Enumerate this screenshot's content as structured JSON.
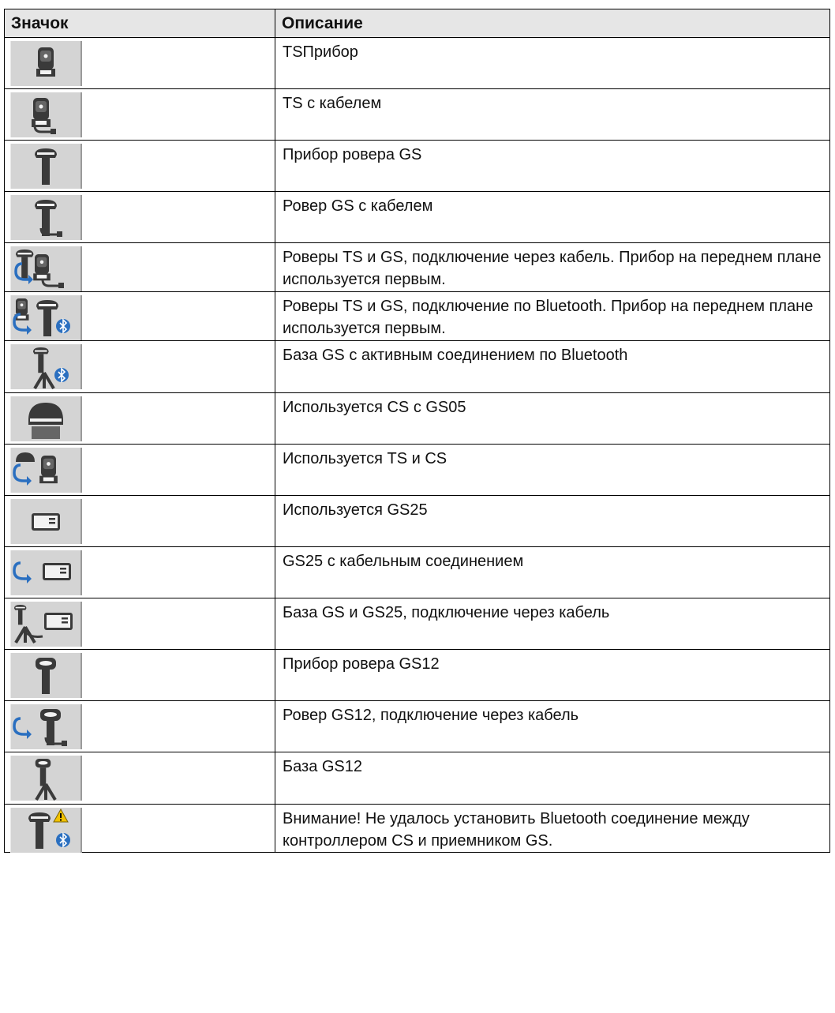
{
  "headers": {
    "icon": "Значок",
    "description": "Описание"
  },
  "rows": [
    {
      "icon": "ts-instrument-icon",
      "description": "TSПрибор"
    },
    {
      "icon": "ts-cable-icon",
      "description": "TS с кабелем"
    },
    {
      "icon": "gs-rover-icon",
      "description": "Прибор ровера GS"
    },
    {
      "icon": "gs-rover-cable-icon",
      "description": "Ровер GS с кабелем"
    },
    {
      "icon": "ts-gs-cable-icon",
      "description": "Роверы TS и GS, подключение через кабель. Прибор на переднем плане используется первым."
    },
    {
      "icon": "ts-gs-bluetooth-icon",
      "description": "Роверы TS и GS, подключение по Bluetooth. Прибор на переднем плане используется первым."
    },
    {
      "icon": "gs-base-bluetooth-icon",
      "description": "База GS с активным соединением по Bluetooth"
    },
    {
      "icon": "cs-gs05-icon",
      "description": "Используется CS с GS05"
    },
    {
      "icon": "ts-cs-icon",
      "description": "Используется TS и CS"
    },
    {
      "icon": "gs25-icon",
      "description": "Используется GS25"
    },
    {
      "icon": "gs25-cable-icon",
      "description": "GS25 с кабельным соединением"
    },
    {
      "icon": "gs-base-gs25-cable-icon",
      "description": "База GS и GS25, подключение через кабель"
    },
    {
      "icon": "gs12-rover-icon",
      "description": "Прибор ровера GS12"
    },
    {
      "icon": "gs12-rover-cable-icon",
      "description": "Ровер GS12, подключение через кабель"
    },
    {
      "icon": "gs12-base-icon",
      "description": "База GS12"
    },
    {
      "icon": "bluetooth-warning-icon",
      "description": "Внимание! Не удалось установить Bluetooth соединение между контроллером CS и приемником GS."
    }
  ]
}
